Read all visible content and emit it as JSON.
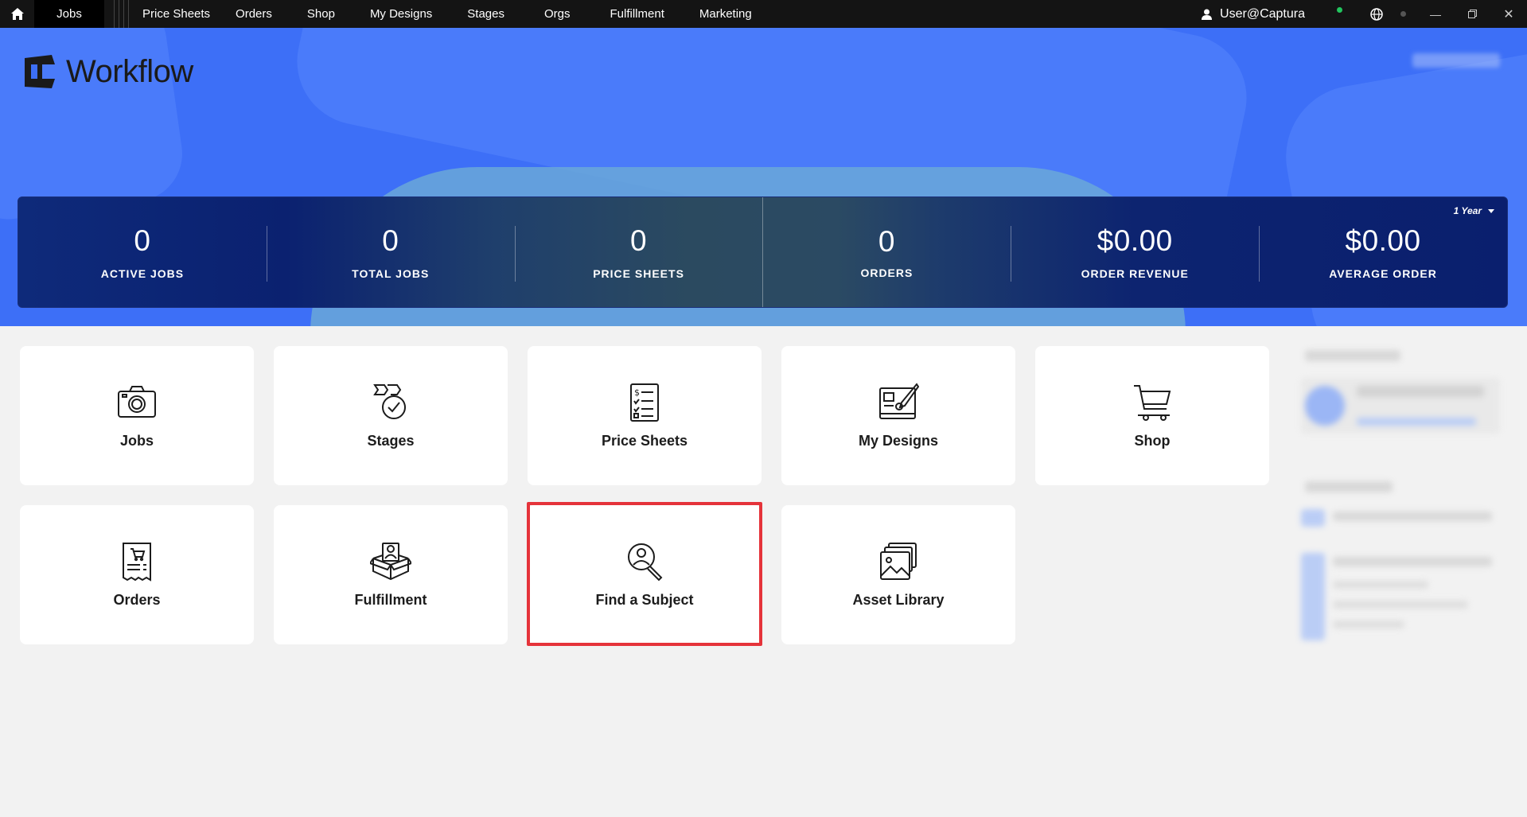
{
  "topbar": {
    "nav": [
      "Jobs",
      "Price Sheets",
      "Orders",
      "Shop",
      "My Designs",
      "Stages",
      "Orgs",
      "Fulfillment",
      "Marketing"
    ],
    "user": "User@Captura"
  },
  "header": {
    "app_name": "Workflow"
  },
  "stats": {
    "period": "1 Year",
    "items": [
      {
        "value": "0",
        "label": "ACTIVE JOBS"
      },
      {
        "value": "0",
        "label": "TOTAL JOBS"
      },
      {
        "value": "0",
        "label": "PRICE SHEETS"
      },
      {
        "value": "0",
        "label": "ORDERS"
      },
      {
        "value": "$0.00",
        "label": "ORDER REVENUE"
      },
      {
        "value": "$0.00",
        "label": "AVERAGE ORDER"
      }
    ]
  },
  "tiles": [
    {
      "label": "Jobs",
      "icon": "camera-icon"
    },
    {
      "label": "Stages",
      "icon": "stages-icon"
    },
    {
      "label": "Price Sheets",
      "icon": "price-sheet-icon"
    },
    {
      "label": "My Designs",
      "icon": "design-icon"
    },
    {
      "label": "Shop",
      "icon": "cart-icon"
    },
    {
      "label": "Orders",
      "icon": "receipt-icon"
    },
    {
      "label": "Fulfillment",
      "icon": "box-icon"
    },
    {
      "label": "Find a Subject",
      "icon": "find-subject-icon"
    },
    {
      "label": "Asset Library",
      "icon": "images-icon"
    }
  ],
  "colors": {
    "accent": "#3d6ff7",
    "stats_bg": "#0b2170",
    "highlight": "#e5333a"
  }
}
